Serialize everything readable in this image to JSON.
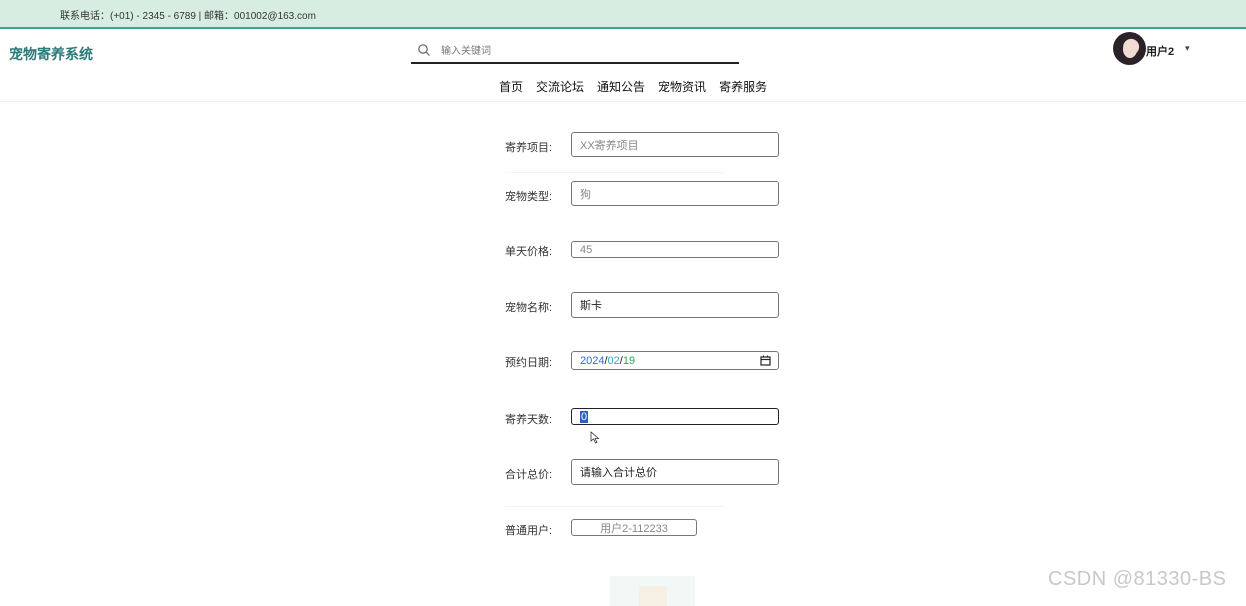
{
  "topbar": {
    "contact": "联系电话：(+01) - 2345 - 6789 | 邮箱：001002@163.com"
  },
  "header": {
    "logo": "宠物寄养系统",
    "search_placeholder": "输入关键词",
    "user_name": "用户2",
    "caret": "▾"
  },
  "nav": [
    "首页",
    "交流论坛",
    "通知公告",
    "宠物资讯",
    "寄养服务"
  ],
  "form": {
    "project": {
      "label": "寄养项目:",
      "value": "XX寄养项目"
    },
    "pet_type": {
      "label": "宠物类型:",
      "value": "狗"
    },
    "daily_price": {
      "label": "单天价格:",
      "value": "45"
    },
    "pet_name": {
      "label": "宠物名称:",
      "value": "斯卡"
    },
    "booking_date": {
      "label": "预约日期:",
      "year": "2024",
      "month": "02",
      "day": "19",
      "sep": "/"
    },
    "days": {
      "label": "寄养天数:",
      "value": "0"
    },
    "total": {
      "label": "合计总价:",
      "value": "请输入合计总价"
    },
    "user": {
      "label": "普通用户:",
      "value": "用户2-112233"
    }
  },
  "watermark": "CSDN @81330-BS"
}
